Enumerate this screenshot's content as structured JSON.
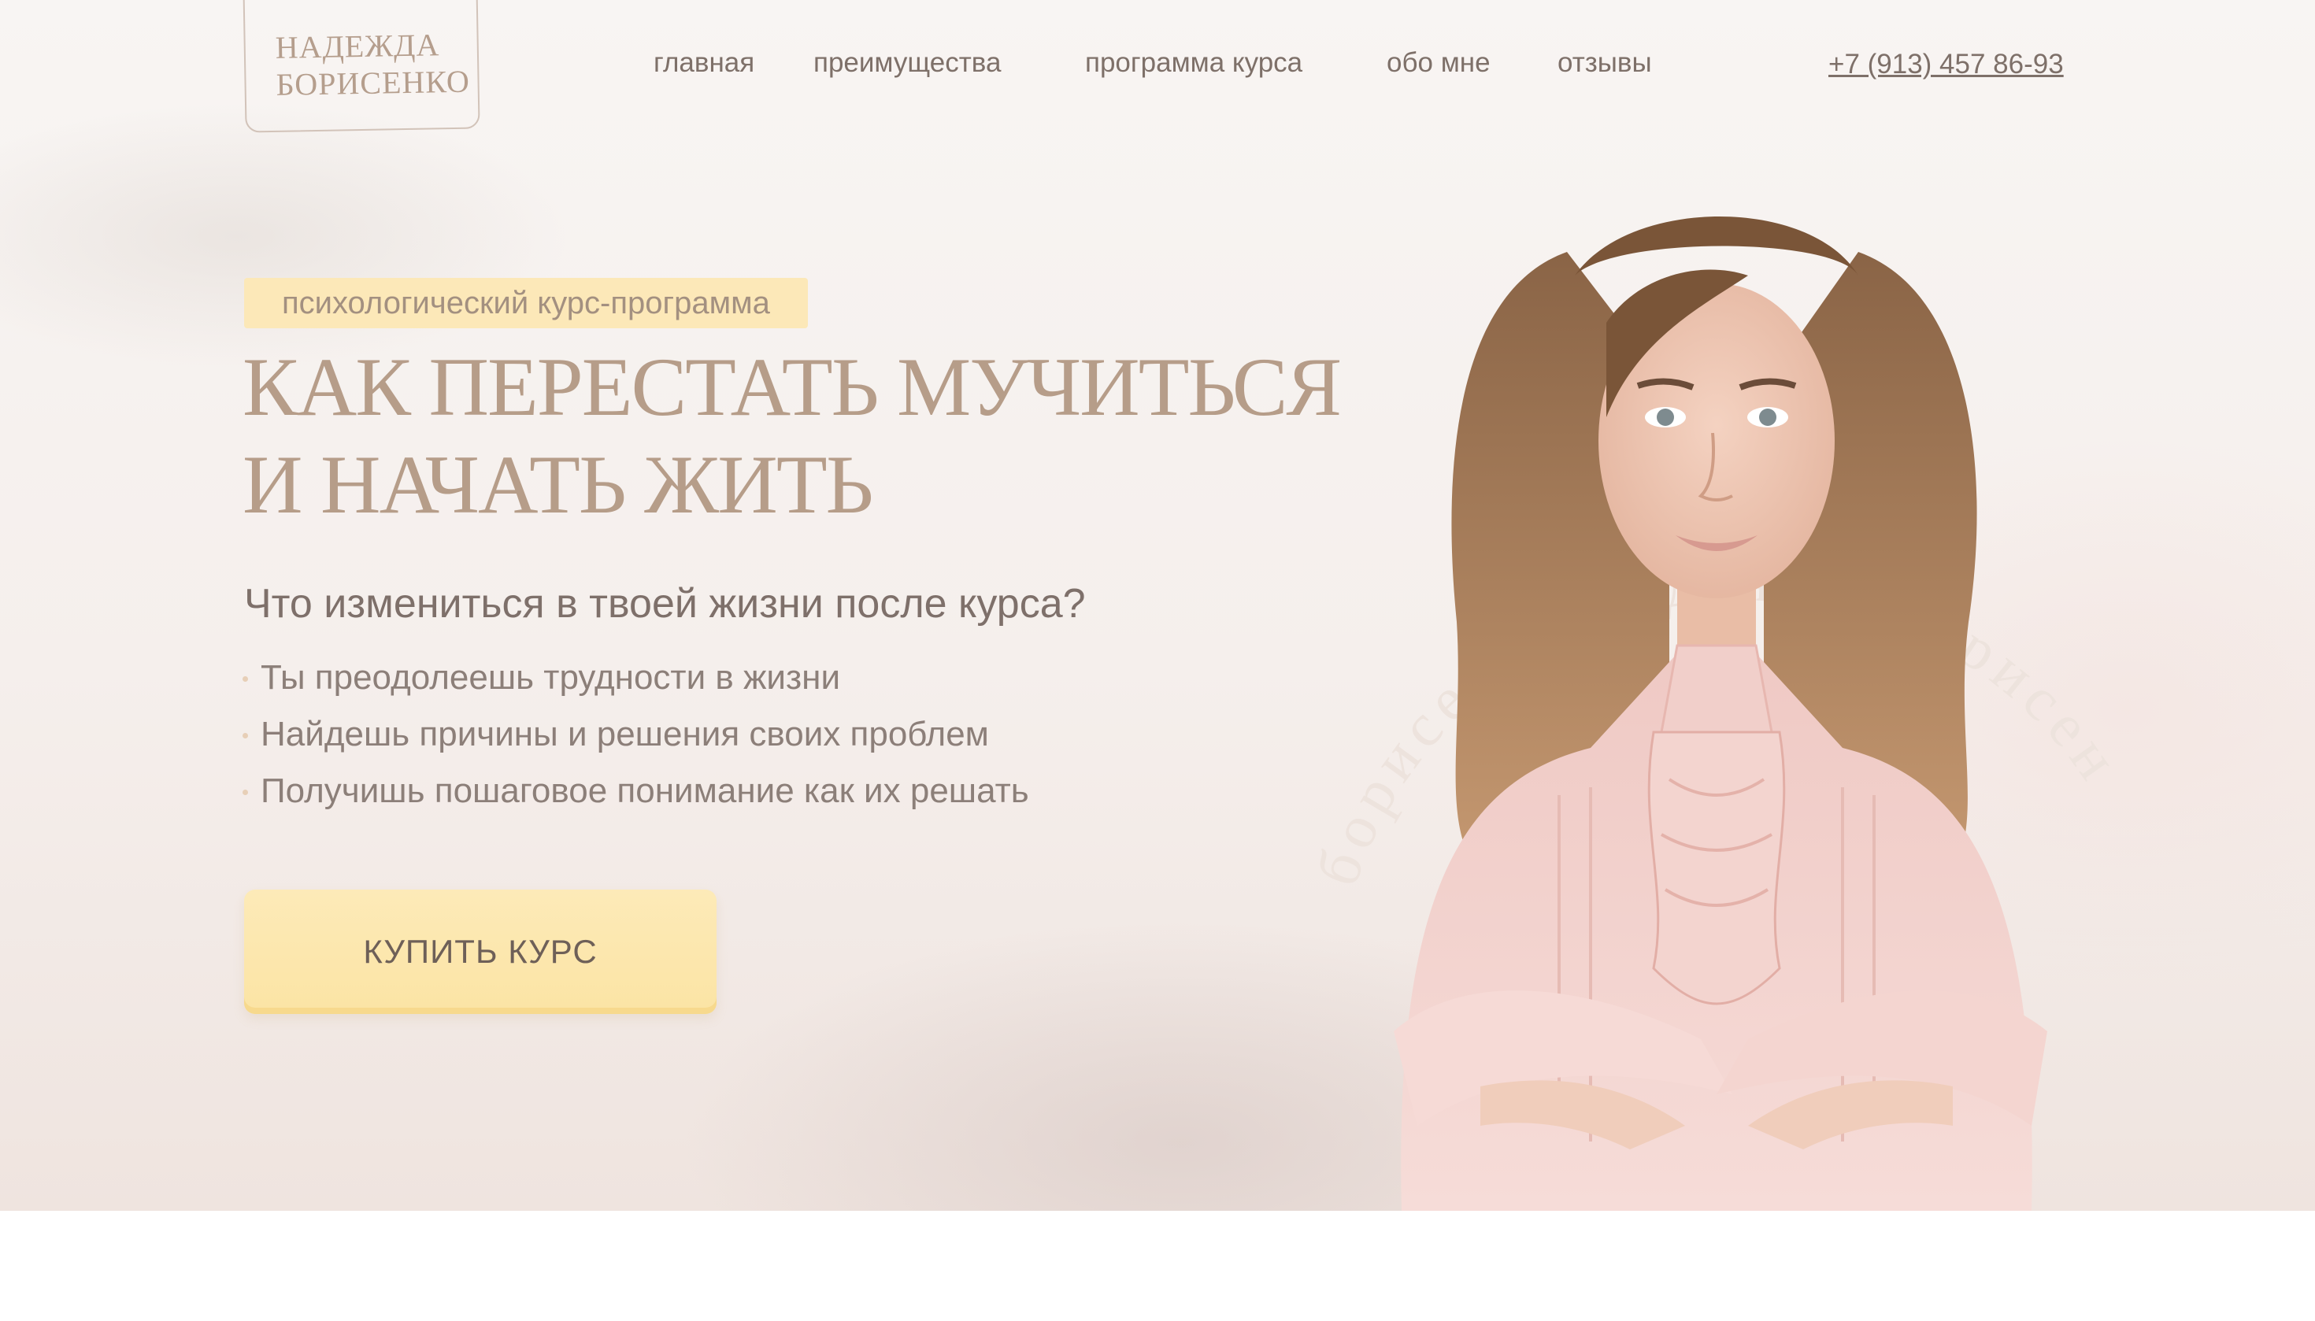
{
  "logo": {
    "line1": "НАДЕЖДА",
    "line2": "БОРИСЕНКО"
  },
  "nav": {
    "items": [
      {
        "label": "главная"
      },
      {
        "label": "преимущества"
      },
      {
        "label": "программа курса"
      },
      {
        "label": "обо мне"
      },
      {
        "label": "отзывы"
      }
    ],
    "phone": "+7 (913) 457 86-93"
  },
  "hero": {
    "badge": "психологический курс-программа",
    "title_line1": "КАК ПЕРЕСТАТЬ МУЧИТЬСЯ",
    "title_line2": "И НАЧАТЬ ЖИТЬ",
    "question": "Что измениться в твоей жизни после курса?",
    "bullets": [
      "Ты преодолеешь трудности в жизни",
      "Найдешь причины и решения своих проблем",
      "Получишь пошаговое понимание как их решать"
    ],
    "buy_label": "КУПИТЬ КУРС",
    "circle_text": "борисенко надежда борисенко надежда борисенко"
  },
  "colors": {
    "accent": "#b69d89",
    "button": "#fce8b8",
    "text": "#7e706a",
    "background": "#f8f5f3"
  }
}
